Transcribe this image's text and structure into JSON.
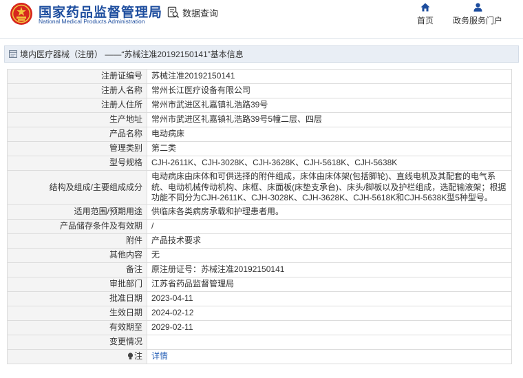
{
  "header": {
    "brand_cn": "国家药品监督管理局",
    "brand_en": "National Medical Products Administration",
    "query_label": "数据查询",
    "nav": [
      {
        "label": "首页",
        "icon": "home-icon"
      },
      {
        "label": "政务服务门户",
        "icon": "user-icon"
      }
    ]
  },
  "breadcrumb": {
    "text": "境内医疗器械（注册） ——“苏械注准20192150141”基本信息"
  },
  "details": {
    "rows": [
      {
        "label": "注册证编号",
        "value": "苏械注准20192150141"
      },
      {
        "label": "注册人名称",
        "value": "常州长江医疗设备有限公司"
      },
      {
        "label": "注册人住所",
        "value": "常州市武进区礼嘉镇礼浩路39号"
      },
      {
        "label": "生产地址",
        "value": "常州市武进区礼嘉镇礼浩路39号5幢二层、四层"
      },
      {
        "label": "产品名称",
        "value": "电动病床"
      },
      {
        "label": "管理类别",
        "value": "第二类"
      },
      {
        "label": "型号规格",
        "value": "CJH-2611K、CJH-3028K、CJH-3628K、CJH-5618K、CJH-5638K"
      },
      {
        "label": "结构及组成/主要组成成分",
        "value": "电动病床由床体和可供选择的附件组成，床体由床体架(包括脚轮)、直线电机及其配套的电气系统、电动机械传动机构、床框、床面板(床垫支承台)、床头/脚板以及护栏组成，选配输液架；根据功能不同分为CJH-2611K、CJH-3028K、CJH-3628K、CJH-5618K和CJH-5638K型5种型号。"
      },
      {
        "label": "适用范围/预期用途",
        "value": "供临床各类病房承载和护理患者用。"
      },
      {
        "label": "产品储存条件及有效期",
        "value": "/"
      },
      {
        "label": "附件",
        "value": "产品技术要求"
      },
      {
        "label": "其他内容",
        "value": "无"
      },
      {
        "label": "备注",
        "value": "原注册证号：苏械注准20192150141"
      },
      {
        "label": "审批部门",
        "value": "江苏省药品监督管理局"
      },
      {
        "label": "批准日期",
        "value": "2023-04-11"
      },
      {
        "label": "生效日期",
        "value": "2024-02-12"
      },
      {
        "label": "有效期至",
        "value": "2029-02-11"
      },
      {
        "label": "变更情况",
        "value": ""
      }
    ],
    "note_label": "注",
    "note_link": "详情"
  }
}
